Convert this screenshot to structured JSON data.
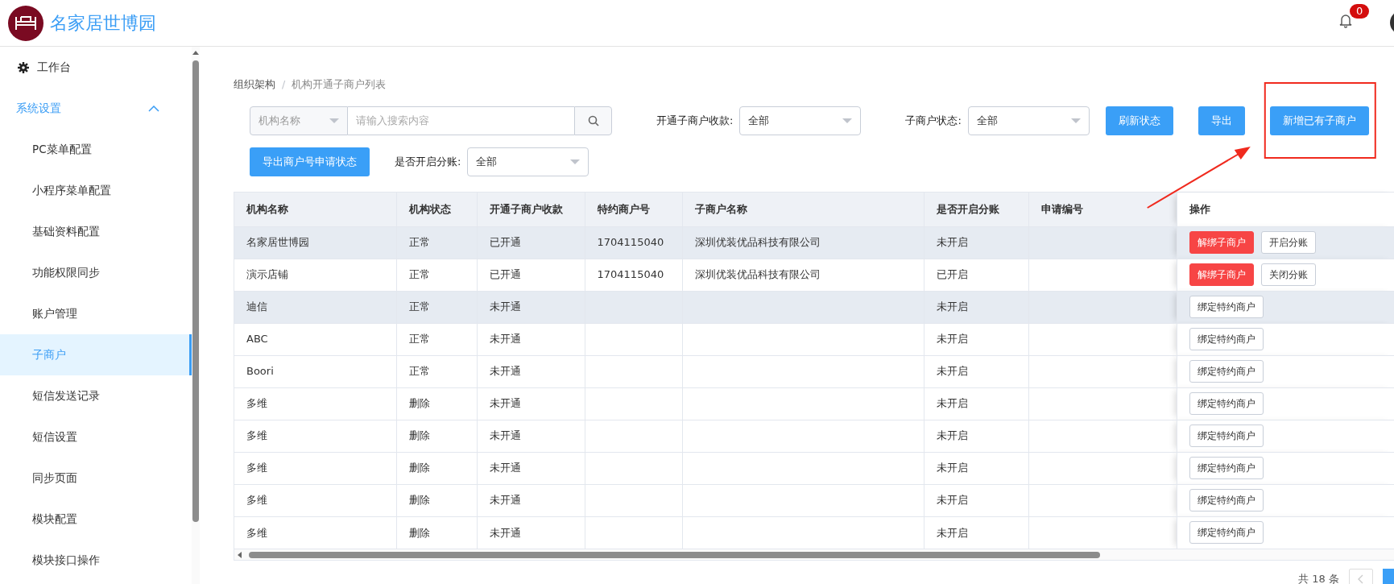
{
  "header": {
    "title": "名家居世博园",
    "notification_count": "0"
  },
  "sidebar": {
    "items": [
      {
        "label": "工作台",
        "kind": "link",
        "selected": false
      },
      {
        "label": "系统设置",
        "kind": "group",
        "selected": false,
        "expanded": true,
        "children": [
          {
            "label": "PC菜单配置",
            "selected": false
          },
          {
            "label": "小程序菜单配置",
            "selected": false
          },
          {
            "label": "基础资料配置",
            "selected": false
          },
          {
            "label": "功能权限同步",
            "selected": false
          },
          {
            "label": "账户管理",
            "selected": false
          },
          {
            "label": "子商户",
            "selected": true
          },
          {
            "label": "短信发送记录",
            "selected": false
          },
          {
            "label": "短信设置",
            "selected": false
          },
          {
            "label": "同步页面",
            "selected": false
          },
          {
            "label": "模块配置",
            "selected": false
          },
          {
            "label": "模块接口操作",
            "selected": false
          }
        ]
      }
    ]
  },
  "breadcrumb": {
    "items": [
      "组织架构",
      "机构开通子商户列表"
    ],
    "separator": "/"
  },
  "toolbar_rows": [
    [
      {
        "kind": "search",
        "select_value": "机构名称",
        "placeholder": "请输入搜索内容"
      },
      {
        "kind": "filter",
        "label": "开通子商户收款:",
        "value": "全部"
      },
      {
        "kind": "filter",
        "label": "子商户状态:",
        "value": "全部"
      },
      {
        "kind": "button",
        "label": "刷新状态",
        "highlighted": false
      },
      {
        "kind": "button",
        "label": "导出",
        "highlighted": false
      },
      {
        "kind": "button",
        "label": "新增已有子商户",
        "highlighted": true
      }
    ],
    [
      {
        "kind": "button",
        "label": "导出商户号申请状态",
        "highlighted": false
      },
      {
        "kind": "filter",
        "label": "是否开启分账:",
        "value": "全部"
      }
    ]
  ],
  "annotation_arrow": true,
  "table": {
    "columns": [
      "机构名称",
      "机构状态",
      "开通子商户收款",
      "特约商户号",
      "子商户名称",
      "是否开启分账",
      "申请编号",
      "操作"
    ],
    "rows": [
      {
        "cells": [
          "名家居世博园",
          "正常",
          "已开通",
          "1704115040",
          "深圳优装优品科技有限公司",
          "未开启",
          ""
        ],
        "highlighted": true,
        "actions": [
          {
            "label": "解绑子商户",
            "kind": "danger"
          },
          {
            "label": "开启分账",
            "kind": "default"
          }
        ]
      },
      {
        "cells": [
          "演示店铺",
          "正常",
          "已开通",
          "1704115040",
          "深圳优装优品科技有限公司",
          "已开启",
          ""
        ],
        "highlighted": false,
        "actions": [
          {
            "label": "解绑子商户",
            "kind": "danger"
          },
          {
            "label": "关闭分账",
            "kind": "default"
          }
        ]
      },
      {
        "cells": [
          "迪信",
          "正常",
          "未开通",
          "",
          "",
          "未开启",
          ""
        ],
        "highlighted": true,
        "actions": [
          {
            "label": "绑定特约商户",
            "kind": "default"
          }
        ]
      },
      {
        "cells": [
          "ABC",
          "正常",
          "未开通",
          "",
          "",
          "未开启",
          ""
        ],
        "highlighted": false,
        "actions": [
          {
            "label": "绑定特约商户",
            "kind": "default"
          }
        ]
      },
      {
        "cells": [
          "Boori",
          "正常",
          "未开通",
          "",
          "",
          "未开启",
          ""
        ],
        "highlighted": false,
        "actions": [
          {
            "label": "绑定特约商户",
            "kind": "default"
          }
        ]
      },
      {
        "cells": [
          "多维",
          "删除",
          "未开通",
          "",
          "",
          "未开启",
          ""
        ],
        "highlighted": false,
        "actions": [
          {
            "label": "绑定特约商户",
            "kind": "default"
          }
        ]
      },
      {
        "cells": [
          "多维",
          "删除",
          "未开通",
          "",
          "",
          "未开启",
          ""
        ],
        "highlighted": false,
        "actions": [
          {
            "label": "绑定特约商户",
            "kind": "default"
          }
        ]
      },
      {
        "cells": [
          "多维",
          "删除",
          "未开通",
          "",
          "",
          "未开启",
          ""
        ],
        "highlighted": false,
        "actions": [
          {
            "label": "绑定特约商户",
            "kind": "default"
          }
        ]
      },
      {
        "cells": [
          "多维",
          "删除",
          "未开通",
          "",
          "",
          "未开启",
          ""
        ],
        "highlighted": false,
        "actions": [
          {
            "label": "绑定特约商户",
            "kind": "default"
          }
        ]
      },
      {
        "cells": [
          "多维",
          "删除",
          "未开通",
          "",
          "",
          "未开启",
          ""
        ],
        "highlighted": false,
        "actions": [
          {
            "label": "绑定特约商户",
            "kind": "default"
          }
        ]
      }
    ]
  },
  "pagination": {
    "total": "共 18 条"
  }
}
